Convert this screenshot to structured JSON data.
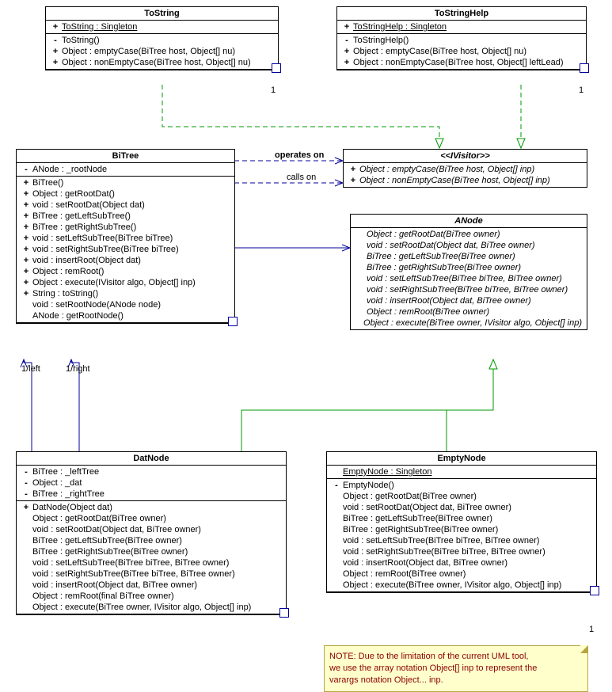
{
  "tostring": {
    "name": "ToString",
    "attrs": [
      {
        "v": "+",
        "t": "ToString : Singleton",
        "u": true
      }
    ],
    "ops": [
      {
        "v": "-",
        "t": "ToString()"
      },
      {
        "v": "+",
        "t": "Object : emptyCase(BiTree host, Object[] nu)"
      },
      {
        "v": "+",
        "t": "Object : nonEmptyCase(BiTree host, Object[] nu)"
      }
    ]
  },
  "tostringhelp": {
    "name": "ToStringHelp",
    "attrs": [
      {
        "v": "+",
        "t": "ToStringHelp : Singleton",
        "u": true
      }
    ],
    "ops": [
      {
        "v": "-",
        "t": "ToStringHelp()"
      },
      {
        "v": "+",
        "t": "Object : emptyCase(BiTree host, Object[] nu)"
      },
      {
        "v": "+",
        "t": "Object : nonEmptyCase(BiTree host, Object[] leftLead)"
      }
    ]
  },
  "bitree": {
    "name": "BiTree",
    "attrs": [
      {
        "v": "-",
        "t": "ANode : _rootNode"
      }
    ],
    "ops": [
      {
        "v": "+",
        "t": "BiTree()"
      },
      {
        "v": "+",
        "t": "Object : getRootDat()"
      },
      {
        "v": "+",
        "t": "void : setRootDat(Object dat)"
      },
      {
        "v": "+",
        "t": "BiTree : getLeftSubTree()"
      },
      {
        "v": "+",
        "t": "BiTree : getRightSubTree()"
      },
      {
        "v": "+",
        "t": "void : setLeftSubTree(BiTree biTree)"
      },
      {
        "v": "+",
        "t": "void : setRightSubTree(BiTree biTree)"
      },
      {
        "v": "+",
        "t": "void : insertRoot(Object dat)"
      },
      {
        "v": "+",
        "t": "Object : remRoot()"
      },
      {
        "v": "+",
        "t": "Object : execute(IVisitor algo, Object[] inp)"
      },
      {
        "v": "+",
        "t": "String : toString()"
      },
      {
        "v": "",
        "t": "void : setRootNode(ANode node)"
      },
      {
        "v": "",
        "t": "ANode : getRootNode()"
      }
    ]
  },
  "ivisitor": {
    "name": "<<IVisitor>>",
    "ops": [
      {
        "v": "+",
        "t": "Object : emptyCase(BiTree host, Object[] inp)",
        "i": true
      },
      {
        "v": "+",
        "t": "Object : nonEmptyCase(BiTree host, Object[] inp)",
        "i": true
      }
    ]
  },
  "anode": {
    "name": "ANode",
    "ops": [
      {
        "t": "Object : getRootDat(BiTree owner)",
        "i": true
      },
      {
        "t": "void : setRootDat(Object dat, BiTree owner)",
        "i": true
      },
      {
        "t": "BiTree : getLeftSubTree(BiTree owner)",
        "i": true
      },
      {
        "t": "BiTree : getRightSubTree(BiTree owner)",
        "i": true
      },
      {
        "t": "void : setLeftSubTree(BiTree biTree, BiTree owner)",
        "i": true
      },
      {
        "t": "void : setRightSubTree(BiTree biTree, BiTree owner)",
        "i": true
      },
      {
        "t": "void : insertRoot(Object dat, BiTree owner)",
        "i": true
      },
      {
        "t": "Object : remRoot(BiTree owner)",
        "i": true
      },
      {
        "t": "Object : execute(BiTree owner, IVisitor algo, Object[] inp)",
        "i": true
      }
    ]
  },
  "datnode": {
    "name": "DatNode",
    "attrs": [
      {
        "v": "-",
        "t": "BiTree : _leftTree"
      },
      {
        "v": "-",
        "t": "Object : _dat"
      },
      {
        "v": "-",
        "t": "BiTree : _rightTree"
      }
    ],
    "ops": [
      {
        "v": "+",
        "t": "DatNode(Object dat)"
      },
      {
        "v": "",
        "t": "Object : getRootDat(BiTree owner)"
      },
      {
        "v": "",
        "t": "void : setRootDat(Object dat, BiTree owner)"
      },
      {
        "v": "",
        "t": "BiTree : getLeftSubTree(BiTree owner)"
      },
      {
        "v": "",
        "t": "BiTree : getRightSubTree(BiTree owner)"
      },
      {
        "v": "",
        "t": "void : setLeftSubTree(BiTree biTree, BiTree owner)"
      },
      {
        "v": "",
        "t": "void : setRightSubTree(BiTree biTree, BiTree owner)"
      },
      {
        "v": "",
        "t": "void : insertRoot(Object dat, BiTree owner)"
      },
      {
        "v": "",
        "t": "Object : remRoot(final BiTree owner)"
      },
      {
        "v": "",
        "t": "Object : execute(BiTree owner, IVisitor algo, Object[] inp)"
      }
    ]
  },
  "emptynode": {
    "name": "EmptyNode",
    "attrs": [
      {
        "v": "",
        "t": "EmptyNode : Singleton",
        "u": true
      }
    ],
    "ops": [
      {
        "v": "-",
        "t": "EmptyNode()"
      },
      {
        "v": "",
        "t": "Object : getRootDat(BiTree owner)"
      },
      {
        "v": "",
        "t": "void : setRootDat(Object dat, BiTree owner)"
      },
      {
        "v": "",
        "t": "BiTree : getLeftSubTree(BiTree owner)"
      },
      {
        "v": "",
        "t": "BiTree : getRightSubTree(BiTree owner)"
      },
      {
        "v": "",
        "t": "void : setLeftSubTree(BiTree biTree, BiTree owner)"
      },
      {
        "v": "",
        "t": "void : setRightSubTree(BiTree biTree, BiTree owner)"
      },
      {
        "v": "",
        "t": "void : insertRoot(Object dat, BiTree owner)"
      },
      {
        "v": "",
        "t": "Object : remRoot(BiTree owner)"
      },
      {
        "v": "",
        "t": "Object : execute(BiTree owner, IVisitor algo, Object[] inp)"
      }
    ]
  },
  "labels": {
    "operates_on": "operates on",
    "calls_on": "calls on",
    "left": "1/left",
    "right": "1/right",
    "one": "1"
  },
  "note": {
    "l1": "NOTE: Due to the limitation of the current UML tool,",
    "l2": "we use the array notation Object[] inp to represent the",
    "l3": "varargs notation Object... inp."
  }
}
